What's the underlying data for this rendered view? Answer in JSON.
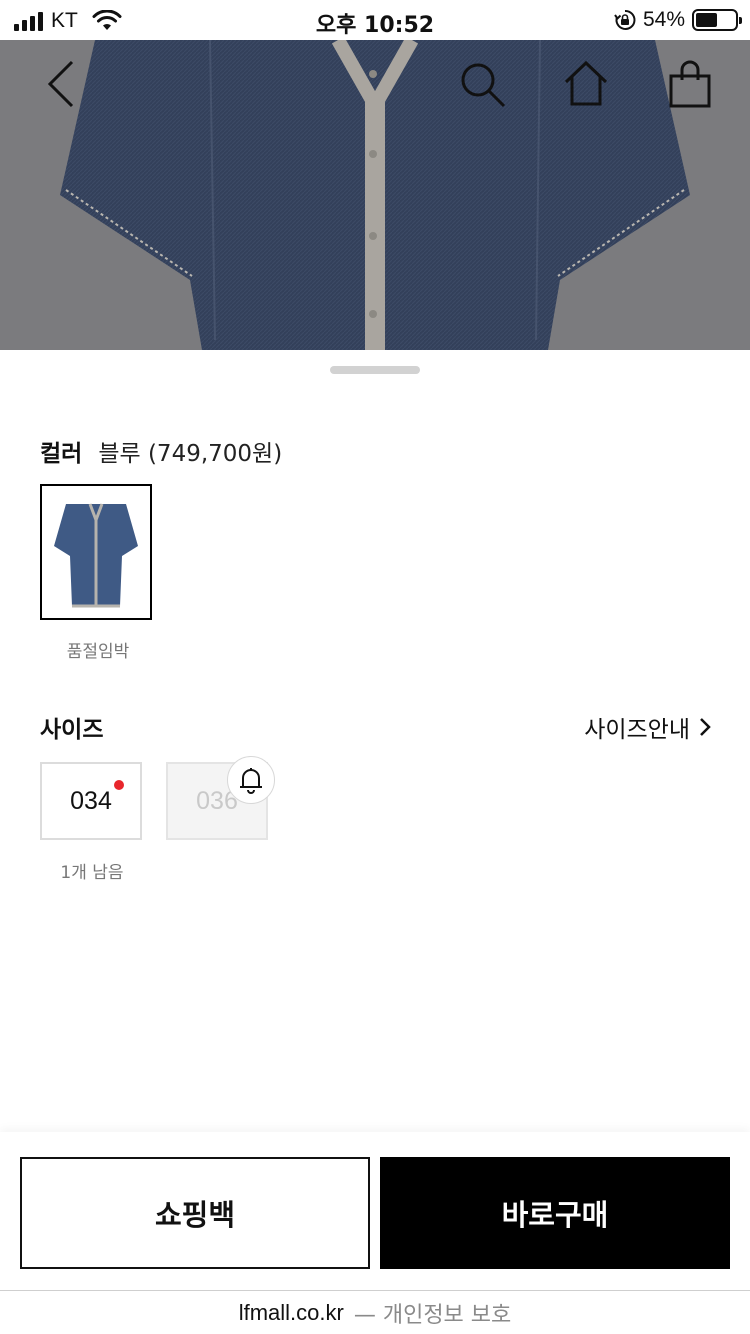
{
  "status_bar": {
    "carrier": "KT",
    "time": "오후 10:52",
    "battery_percent": "54%",
    "battery_level": 0.54
  },
  "nav": {
    "icons": [
      "back-icon",
      "search-icon",
      "home-icon",
      "shopping-bag-icon"
    ]
  },
  "product_image": {
    "background": "#7b7b7e",
    "garment_color": "#33405a",
    "trim_color": "#a9a59f"
  },
  "color_section": {
    "label": "컬러",
    "selected": "블루 (749,700원)",
    "swatches": [
      {
        "note": "품절임박"
      }
    ]
  },
  "size_section": {
    "label": "사이즈",
    "guide_label": "사이즈안내",
    "sizes": [
      {
        "label": "034",
        "available": true,
        "note": "1개 남음"
      },
      {
        "label": "036",
        "available": false
      }
    ]
  },
  "actions": {
    "bag_label": "쇼핑백",
    "buy_label": "바로구매"
  },
  "footer": {
    "domain": "lfmall.co.kr",
    "privacy": "— 개인정보 보호"
  }
}
